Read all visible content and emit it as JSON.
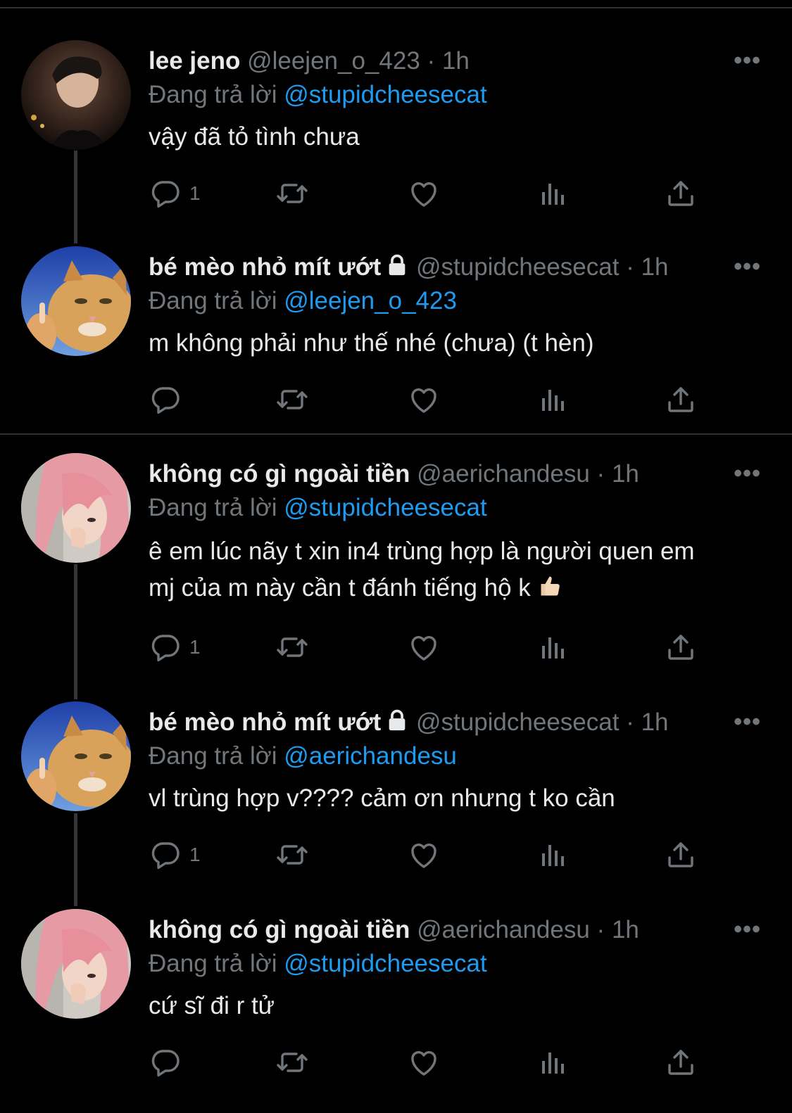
{
  "tweets": [
    {
      "name": "lee jeno",
      "handle": "@leejen_o_423",
      "sep": "·",
      "time": "1h",
      "replying_prefix": "Đang trả lời",
      "replying_to": "@stupidcheesecat",
      "text": "vậy đã tỏ tình chưa",
      "reply_count": "1",
      "locked": false,
      "avatar": "avatar-man"
    },
    {
      "name": "bé mèo nhỏ mít ướt",
      "handle": "@stupidcheesecat",
      "sep": "·",
      "time": "1h",
      "replying_prefix": "Đang trả lời",
      "replying_to": "@leejen_o_423",
      "text": "m không phải như thế nhé (chưa) (t hèn)",
      "reply_count": "",
      "locked": true,
      "avatar": "avatar-cat"
    },
    {
      "name": "không có gì ngoài tiền",
      "handle": "@aerichandesu",
      "sep": "·",
      "time": "1h",
      "replying_prefix": "Đang trả lời",
      "replying_to": "@stupidcheesecat",
      "text_line1": "ê em lúc nãy t xin in4 trùng hợp là người quen em",
      "text_line2": "mj của m này cần t đánh tiếng hộ k",
      "reply_count": "1",
      "locked": false,
      "avatar": "avatar-pink-hair"
    },
    {
      "name": "bé mèo nhỏ mít ướt",
      "handle": "@stupidcheesecat",
      "sep": "·",
      "time": "1h",
      "replying_prefix": "Đang trả lời",
      "replying_to": "@aerichandesu",
      "text": "vl trùng hợp v???? cảm ơn nhưng t ko cần",
      "reply_count": "1",
      "locked": true,
      "avatar": "avatar-cat"
    },
    {
      "name": "không có gì ngoài tiền",
      "handle": "@aerichandesu",
      "sep": "·",
      "time": "1h",
      "replying_prefix": "Đang trả lời",
      "replying_to": "@stupidcheesecat",
      "text": "cứ sĩ đi r tử",
      "reply_count": "",
      "locked": false,
      "avatar": "avatar-pink-hair"
    }
  ],
  "icons": {
    "reply": "reply-icon",
    "retweet": "retweet-icon",
    "like": "like-icon",
    "views": "views-icon",
    "share": "share-icon",
    "more": "more-icon",
    "lock": "lock-icon",
    "thumbs_up": "thumbs-up-emoji"
  },
  "colors": {
    "background": "#000000",
    "text": "#e7e9ea",
    "secondary": "#71767b",
    "link": "#1d9bf0",
    "divider": "#2f3336"
  }
}
